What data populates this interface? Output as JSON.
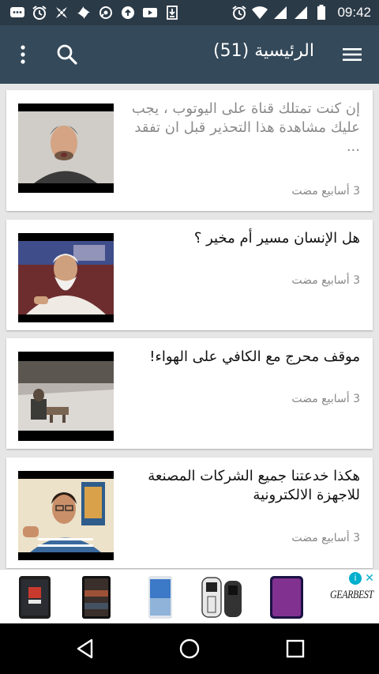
{
  "status_bar": {
    "time": "09:42",
    "icons": [
      "chat-icon",
      "alarm-icon",
      "app-icon",
      "pinwheel-icon",
      "settings-icon",
      "upload-icon",
      "play-icon",
      "download-icon",
      "alarm-icon",
      "wifi-icon",
      "signal-icon",
      "signal-icon",
      "battery-icon"
    ]
  },
  "app_bar": {
    "title": "الرئيسية (51)",
    "icons": [
      "menu-icon",
      "search-icon",
      "more-vert-icon"
    ],
    "color": "#34495a"
  },
  "posts": [
    {
      "title": "إن كنت تمتلك قناة على اليوتوب ، يجب عليك مشاهدة هذا التحذير قبل ان تفقد ...",
      "time": "3 أسابيع مضت",
      "read": true
    },
    {
      "title": "هل الإنسان مسير أم مخير ؟",
      "time": "3 أسابيع مضت",
      "read": false
    },
    {
      "title": "موقف محرج مع الكافي على الهواء!",
      "time": "3 أسابيع مضت",
      "read": false
    },
    {
      "title": "هكذا خدعتنا جميع الشركات المصنعة للاجهزة الالكترونية",
      "time": "3 أسابيع مضت",
      "read": false
    }
  ],
  "ad": {
    "brand": "GEARBEST",
    "info_label": "i",
    "close_label": "✕",
    "products": [
      "phone-image",
      "phone-image",
      "phone-image",
      "feature-phone-image",
      "phone-image"
    ]
  },
  "nav_bar": {
    "icons": [
      "back-icon",
      "home-icon",
      "recents-icon"
    ]
  }
}
